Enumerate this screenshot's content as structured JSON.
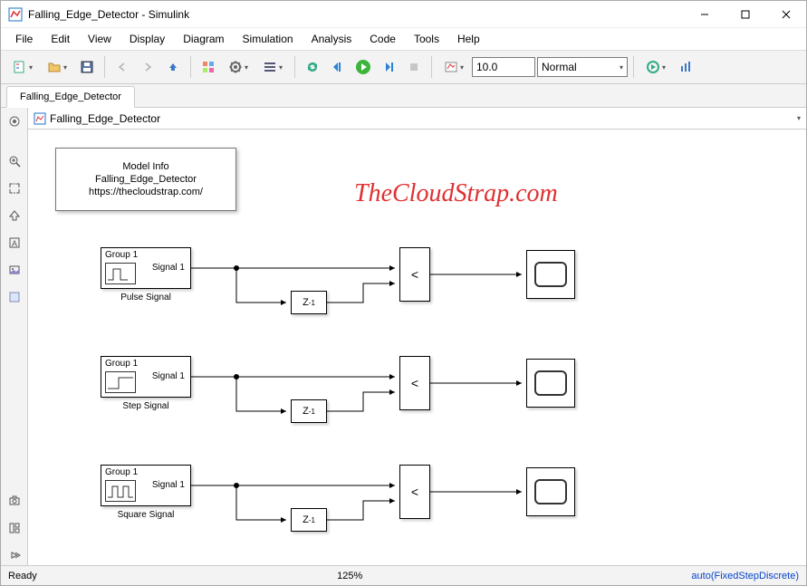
{
  "window": {
    "title": "Falling_Edge_Detector - Simulink"
  },
  "menubar": {
    "file": "File",
    "edit": "Edit",
    "view": "View",
    "display": "Display",
    "diagram": "Diagram",
    "simulation": "Simulation",
    "analysis": "Analysis",
    "code": "Code",
    "tools": "Tools",
    "help": "Help"
  },
  "toolbar": {
    "stop_time": "10.0",
    "sim_mode": "Normal"
  },
  "tabs": {
    "model_tab": "Falling_Edge_Detector"
  },
  "breadcrumb": {
    "model": "Falling_Edge_Detector"
  },
  "model_info": {
    "line1": "Model Info",
    "line2": "Falling_Edge_Detector",
    "line3": "https://thecloudstrap.com/"
  },
  "watermark": "TheCloudStrap.com",
  "chains": [
    {
      "group": "Group 1",
      "signal_port": "Signal 1",
      "label": "Pulse Signal",
      "delay_label": "Z",
      "delay_exp": "-1",
      "op": "<"
    },
    {
      "group": "Group 1",
      "signal_port": "Signal 1",
      "label": "Step Signal",
      "delay_label": "Z",
      "delay_exp": "-1",
      "op": "<"
    },
    {
      "group": "Group 1",
      "signal_port": "Signal 1",
      "label": "Square Signal",
      "delay_label": "Z",
      "delay_exp": "-1",
      "op": "<"
    }
  ],
  "statusbar": {
    "ready": "Ready",
    "zoom": "125%",
    "solver": "auto(FixedStepDiscrete)"
  }
}
